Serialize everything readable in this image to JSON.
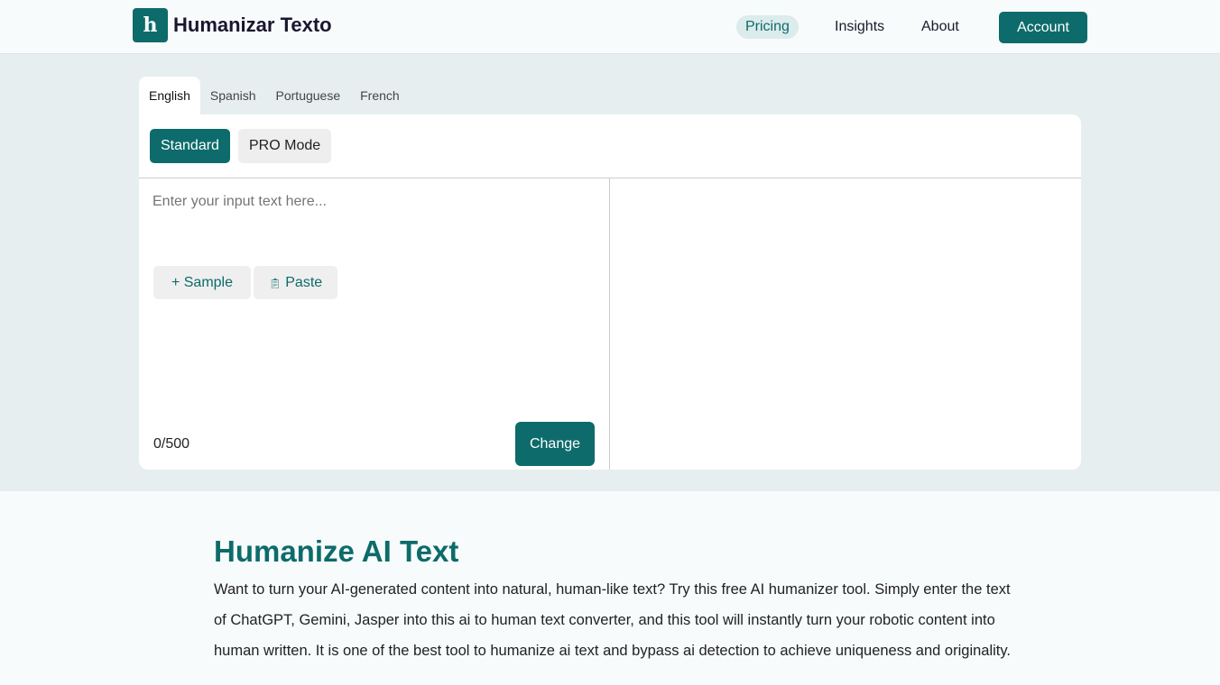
{
  "brand": {
    "logo_letter": "h",
    "name": "Humanizar Texto"
  },
  "nav": {
    "pricing": "Pricing",
    "insights": "Insights",
    "about": "About",
    "account": "Account"
  },
  "tabs": [
    "English",
    "Spanish",
    "Portuguese",
    "French"
  ],
  "modes": {
    "standard": "Standard",
    "pro": "PRO Mode"
  },
  "editor": {
    "placeholder": "Enter your input text here...",
    "sample": "+ Sample",
    "paste": "Paste",
    "paste_icon": "clipboard-icon",
    "count": "0/500",
    "change": "Change"
  },
  "content": {
    "title": "Humanize AI Text",
    "body": "Want to turn your AI-generated content into natural, human-like text? Try this free AI humanizer tool. Simply enter the text of ChatGPT, Gemini, Jasper into this ai to human text converter, and this tool will instantly turn your robotic content into human written. It is one of the best tool to humanize ai text and bypass ai detection to achieve uniqueness and originality."
  }
}
